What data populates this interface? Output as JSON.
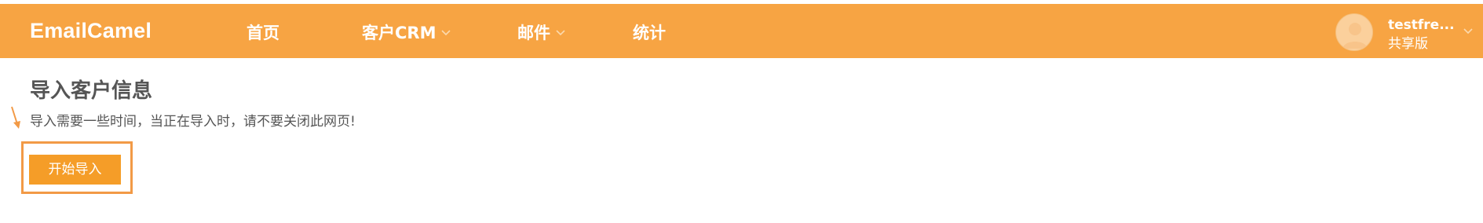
{
  "brand": {
    "name": "EmailCamel"
  },
  "nav": {
    "items": [
      {
        "label": "首页",
        "has_dropdown": false
      },
      {
        "label": "客户CRM",
        "has_dropdown": true
      },
      {
        "label": "邮件",
        "has_dropdown": true
      },
      {
        "label": "统计",
        "has_dropdown": false
      }
    ]
  },
  "user": {
    "name": "testfre...",
    "plan": "共享版"
  },
  "main": {
    "title": "导入客户信息",
    "subtitle": "导入需要一些时间，当正在导入时，请不要关闭此网页!",
    "start_button_label": "开始导入"
  },
  "colors": {
    "navbar": "#f7a443",
    "button": "#f59d28",
    "highlight": "#f29a46",
    "text": "#555555"
  },
  "icons": {
    "dropdown": "chevron-down-icon",
    "avatar": "user-avatar-icon",
    "annotation": "arrow-icon"
  }
}
